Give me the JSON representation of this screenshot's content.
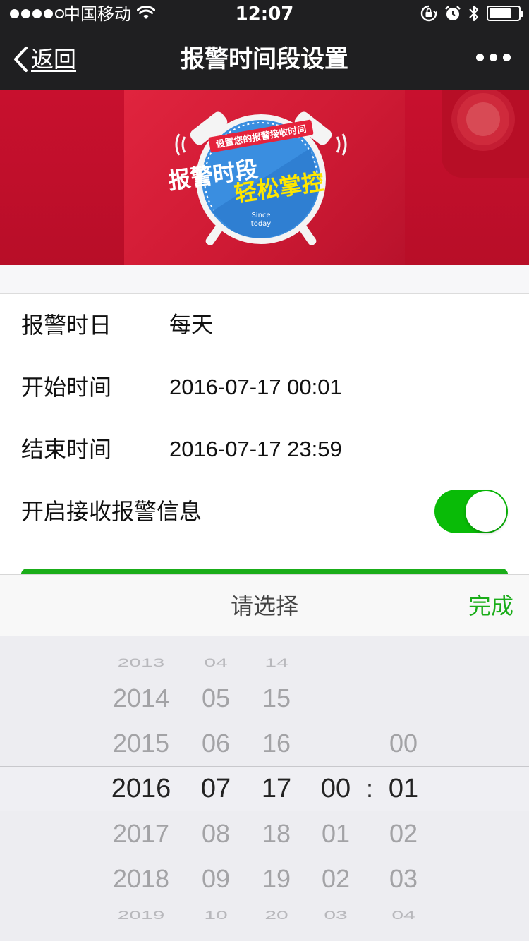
{
  "status_bar": {
    "carrier": "中国移动",
    "time": "12:07",
    "battery_level": 0.75
  },
  "navbar": {
    "back_label": "返回",
    "title": "报警时间段设置"
  },
  "banner": {
    "ribbon_text": "设置您的报警接收时间",
    "headline_1": "报警时段",
    "headline_2": "轻松掌控",
    "since_1": "Since",
    "since_2": "today",
    "colors": {
      "background": "#c8102e",
      "clock_face": "#3a8ee0",
      "accent": "#ffe600"
    }
  },
  "form": {
    "rows": [
      {
        "label": "报警时日",
        "value": "每天"
      },
      {
        "label": "开始时间",
        "value": "2016-07-17 00:01"
      },
      {
        "label": "结束时间",
        "value": "2016-07-17 23:59"
      }
    ],
    "alert_toggle": {
      "label": "开启接收报警信息",
      "on": true
    }
  },
  "picker": {
    "title": "请选择",
    "done_label": "完成",
    "columns": {
      "year": [
        "2013",
        "2014",
        "2015",
        "2016",
        "2017",
        "2018",
        "2019"
      ],
      "month": [
        "04",
        "05",
        "06",
        "07",
        "08",
        "09",
        "10"
      ],
      "day": [
        "14",
        "15",
        "16",
        "17",
        "18",
        "19",
        "20"
      ],
      "hour": [
        "",
        "",
        "",
        "00",
        "01",
        "02",
        "03"
      ],
      "minute": [
        "",
        "",
        "00",
        "01",
        "02",
        "03",
        "04"
      ]
    },
    "separator": ":",
    "selected_index": 3,
    "colors": {
      "accent": "#1aad19"
    }
  }
}
